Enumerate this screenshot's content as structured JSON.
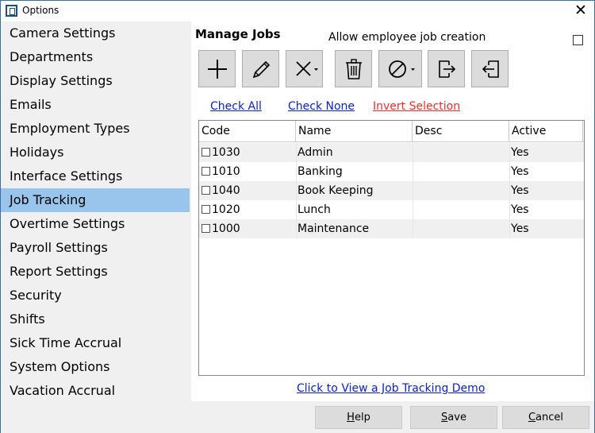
{
  "window": {
    "title": "Options",
    "close_glyph": "✕"
  },
  "sidebar": {
    "items": [
      {
        "label": "Camera Settings"
      },
      {
        "label": "Departments"
      },
      {
        "label": "Display Settings"
      },
      {
        "label": "Emails"
      },
      {
        "label": "Employment Types"
      },
      {
        "label": "Holidays"
      },
      {
        "label": "Interface Settings"
      },
      {
        "label": "Job Tracking",
        "selected": true
      },
      {
        "label": "Overtime Settings"
      },
      {
        "label": "Payroll Settings"
      },
      {
        "label": "Report Settings"
      },
      {
        "label": "Security"
      },
      {
        "label": "Shifts"
      },
      {
        "label": "Sick Time Accrual"
      },
      {
        "label": "System Options"
      },
      {
        "label": "Vacation Accrual"
      }
    ],
    "selected_color": "#99c4eb"
  },
  "main": {
    "heading": "Manage Jobs",
    "allow_label": "Allow employee job creation",
    "allow_checked": false,
    "toolbar": [
      {
        "icon": "plus-icon"
      },
      {
        "icon": "pencil-icon"
      },
      {
        "icon": "x-dropdown-icon"
      },
      {
        "icon": "trash-icon"
      },
      {
        "icon": "no-symbol-dropdown-icon"
      },
      {
        "icon": "export-icon"
      },
      {
        "icon": "import-icon"
      }
    ],
    "links": {
      "check_all": "Check All",
      "check_none": "Check None",
      "invert_selection": "Invert Selection"
    },
    "table": {
      "columns": [
        "Code",
        "Name",
        "Desc",
        "Active"
      ],
      "rows": [
        {
          "code": "1030",
          "name": "Admin",
          "desc": "",
          "active": "Yes"
        },
        {
          "code": "1010",
          "name": "Banking",
          "desc": "",
          "active": "Yes"
        },
        {
          "code": "1040",
          "name": "Book Keeping",
          "desc": "",
          "active": "Yes"
        },
        {
          "code": "1020",
          "name": "Lunch",
          "desc": "",
          "active": "Yes"
        },
        {
          "code": "1000",
          "name": "Maintenance",
          "desc": "",
          "active": "Yes"
        }
      ]
    },
    "demo_link": "Click to View a Job Tracking Demo"
  },
  "footer": {
    "help": {
      "first": "H",
      "rest": "elp"
    },
    "save": {
      "first": "S",
      "rest": "ave"
    },
    "cancel": {
      "first": "C",
      "rest": "ancel"
    }
  },
  "colors": {
    "link_blue": "#0b22c9",
    "link_red": "#e8312d",
    "title_border": "#3c6d9c"
  }
}
